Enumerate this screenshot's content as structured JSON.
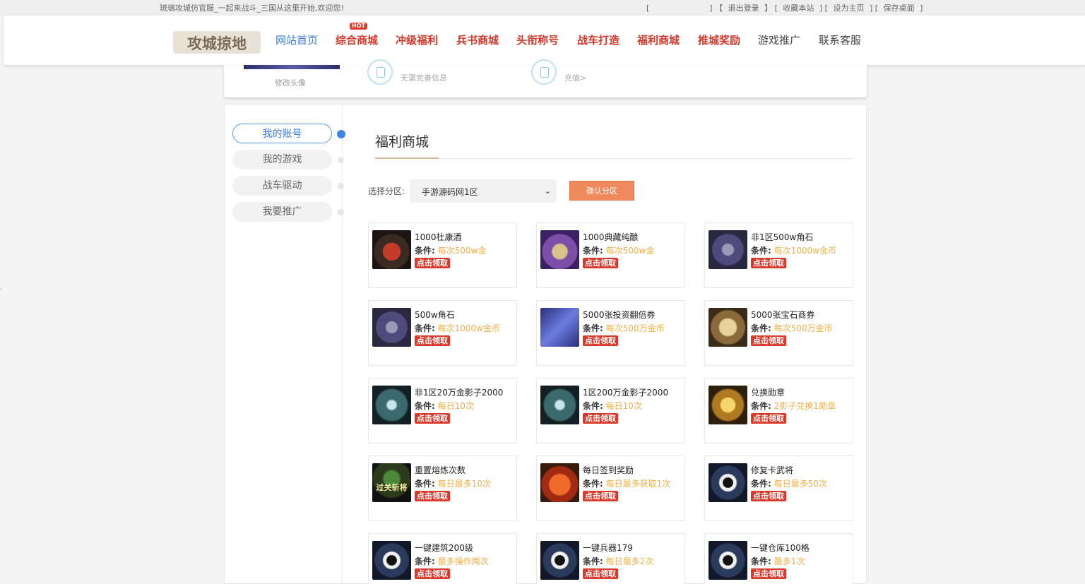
{
  "topbar": {
    "welcome": "琉璃攻城仿官服_一起来战斗_三国从这里开始,欢迎您!",
    "bracket_left": "[",
    "bracket_mid": "] 【",
    "logout": "退出登录",
    "sep1": "】 [",
    "bookmark": "收藏本站",
    "sep2": "] [",
    "homepage": "设为主页",
    "sep3": "] [",
    "save_desktop": "保存桌面",
    "sep4": "]"
  },
  "nav": {
    "logo_text": "攻城掠地",
    "hot_badge": "HOT",
    "items": [
      {
        "label": "网站首页"
      },
      {
        "label": "综合商城"
      },
      {
        "label": "冲级福利"
      },
      {
        "label": "兵书商城"
      },
      {
        "label": "头衔称号"
      },
      {
        "label": "战车打造"
      },
      {
        "label": "福利商城"
      },
      {
        "label": "推城奖励"
      },
      {
        "label": "游戏推广"
      },
      {
        "label": "联系客服"
      }
    ]
  },
  "profile": {
    "avatar_label": "修改头像",
    "info_sub": "无需完善信息",
    "recharge_sub": "充值>"
  },
  "sidebar": {
    "items": [
      {
        "label": "我的账号"
      },
      {
        "label": "我的游戏"
      },
      {
        "label": "战车驱动"
      },
      {
        "label": "我要推广"
      }
    ]
  },
  "main": {
    "title": "福利商城",
    "zone_label": "选择分区:",
    "zone_value": "手游源码网1区",
    "confirm_label": "确认分区",
    "cond_key": "条件:",
    "claim_label": "点击领取",
    "items": [
      {
        "name": "1000杜康酒",
        "cond": "每次500w金",
        "icon": "wine-jar-icon"
      },
      {
        "name": "1000典藏纯酿",
        "cond": "每次500w金",
        "icon": "wine-pot-icon"
      },
      {
        "name": "非1区500w角石",
        "cond": "每次1000w金币",
        "icon": "horn-stone-icon"
      },
      {
        "name": "500w角石",
        "cond": "每次1000w金币",
        "icon": "horn-stone-icon"
      },
      {
        "name": "5000张投资翻倍券",
        "cond": "每次500万金币",
        "icon": "ticket-icon"
      },
      {
        "name": "5000张宝石商券",
        "cond": "每次500万金币",
        "icon": "scroll-icon"
      },
      {
        "name": "非1区20万金影子2000",
        "cond": "每日10次",
        "icon": "shadow-icon"
      },
      {
        "name": "1区200万金影子2000",
        "cond": "每日10次",
        "icon": "shadow-icon"
      },
      {
        "name": "兑换勋章",
        "cond": "2影子兑换1勋章",
        "icon": "medal-icon"
      },
      {
        "name": "重置熔炼次数",
        "cond": "每日最多10次",
        "icon": "general-icon",
        "glyph": "过关斩将"
      },
      {
        "name": "每日签到奖励",
        "cond": "每日最多获取1次",
        "icon": "gift-icon"
      },
      {
        "name": "修复卡武将",
        "cond": "每日最多50次",
        "icon": "yin-yang-icon"
      },
      {
        "name": "一键建筑200级",
        "cond": "最多操作两次",
        "icon": "yin-yang-icon"
      },
      {
        "name": "一键兵器179",
        "cond": "每日最多2次",
        "icon": "yin-yang-icon"
      },
      {
        "name": "一键仓库100格",
        "cond": "最多1次",
        "icon": "yin-yang-icon"
      }
    ]
  },
  "colors": {
    "accent_blue": "#3b7bd8",
    "nav_red": "#d33a2c",
    "cond_orange": "#f0b14a",
    "confirm_btn": "#ef8a5e",
    "claim_red": "#d93a2b"
  }
}
